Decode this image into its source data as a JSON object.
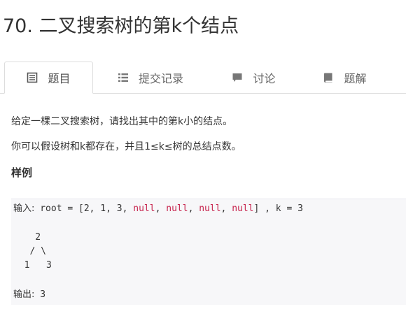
{
  "problem": {
    "title": "70. 二叉搜索树的第k个结点"
  },
  "tabs": [
    {
      "label": "题目",
      "icon": "document-list-icon",
      "active": true
    },
    {
      "label": "提交记录",
      "icon": "list-icon",
      "active": false
    },
    {
      "label": "讨论",
      "icon": "comment-icon",
      "active": false
    },
    {
      "label": "题解",
      "icon": "book-icon",
      "active": false
    }
  ],
  "description": {
    "line1": "给定一棵二叉搜索树，请找出其中的第k小的结点。",
    "line2": "你可以假设树和k都存在，并且1≤k≤树的总结点数。"
  },
  "example": {
    "heading": "样例",
    "input_label": "输入:",
    "root_assign": " root = [2, 1, 3, ",
    "null_token": "null",
    "comma_sep": ", ",
    "input_tail": "] , k = 3",
    "tree_line1": "    2",
    "tree_line2": "   / \\",
    "tree_line3": "  1   3",
    "output_label": "输出:",
    "output_value": " 3"
  },
  "colors": {
    "code_background": "#f7f7f9",
    "null_keyword": "#c7254e",
    "tab_border": "#dddddd",
    "text": "#333333"
  }
}
